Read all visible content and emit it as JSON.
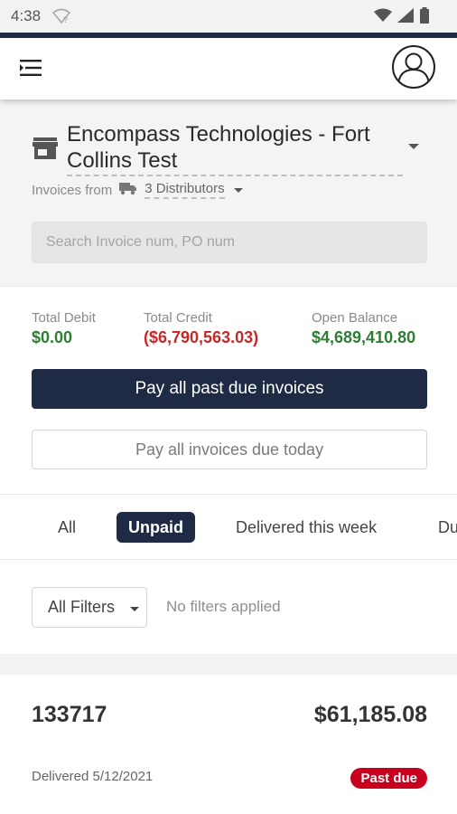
{
  "status_bar": {
    "time": "4:38"
  },
  "header": {
    "store_name": "Encompass Technologies - Fort Collins Test",
    "invoices_from_label": "Invoices from",
    "distributors_label": "3 Distributors",
    "search_placeholder": "Search Invoice num, PO num"
  },
  "totals": {
    "debit_label": "Total Debit",
    "debit_value": "$0.00",
    "credit_label": "Total Credit",
    "credit_value": "($6,790,563.03)",
    "balance_label": "Open Balance",
    "balance_value": "$4,689,410.80"
  },
  "actions": {
    "pay_past_due": "Pay all past due invoices",
    "pay_due_today": "Pay all invoices due today"
  },
  "tabs": [
    {
      "label": "All"
    },
    {
      "label": "Unpaid"
    },
    {
      "label": "Delivered this week"
    },
    {
      "label": "Du"
    }
  ],
  "filters": {
    "button_label": "All Filters",
    "status_text": "No filters applied"
  },
  "invoices": [
    {
      "number": "133717",
      "amount": "$61,185.08",
      "delivered": "Delivered 5/12/2021",
      "badge": "Past due"
    }
  ],
  "colors": {
    "navy": "#1f2a44",
    "debit_green": "#2e7d32",
    "credit_red": "#c62828",
    "past_due_red": "#c8001e"
  }
}
